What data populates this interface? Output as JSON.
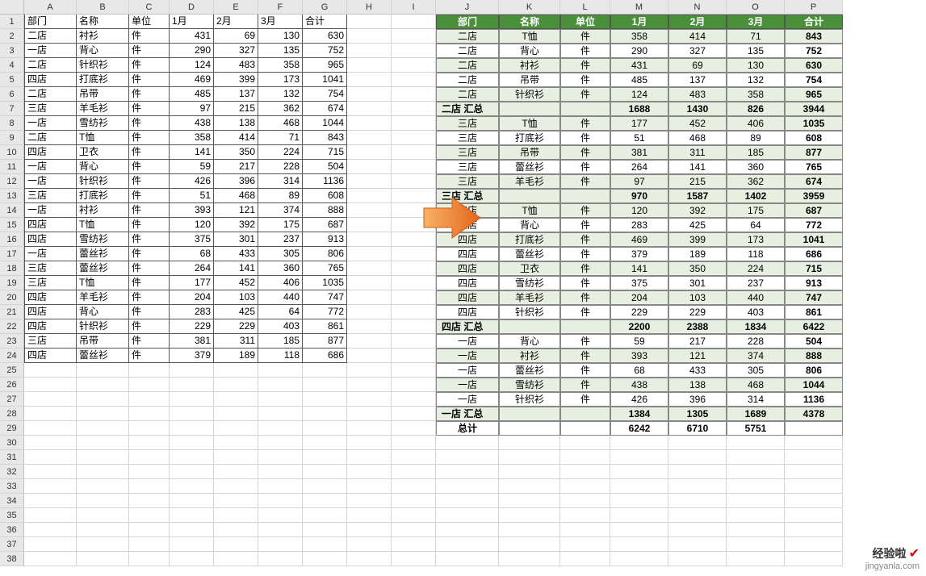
{
  "columns": [
    "A",
    "B",
    "C",
    "D",
    "E",
    "F",
    "G",
    "H",
    "I",
    "J",
    "K",
    "L",
    "M",
    "N",
    "O",
    "P"
  ],
  "row_count": 38,
  "left_table": {
    "headers": [
      "部门",
      "名称",
      "单位",
      "1月",
      "2月",
      "3月",
      "合计"
    ],
    "rows": [
      [
        "二店",
        "衬衫",
        "件",
        431,
        69,
        130,
        630
      ],
      [
        "一店",
        "背心",
        "件",
        290,
        327,
        135,
        752
      ],
      [
        "二店",
        "针织衫",
        "件",
        124,
        483,
        358,
        965
      ],
      [
        "四店",
        "打底衫",
        "件",
        469,
        399,
        173,
        1041
      ],
      [
        "二店",
        "吊带",
        "件",
        485,
        137,
        132,
        754
      ],
      [
        "三店",
        "羊毛衫",
        "件",
        97,
        215,
        362,
        674
      ],
      [
        "一店",
        "雪纺衫",
        "件",
        438,
        138,
        468,
        1044
      ],
      [
        "二店",
        "T恤",
        "件",
        358,
        414,
        71,
        843
      ],
      [
        "四店",
        "卫衣",
        "件",
        141,
        350,
        224,
        715
      ],
      [
        "一店",
        "背心",
        "件",
        59,
        217,
        228,
        504
      ],
      [
        "一店",
        "针织衫",
        "件",
        426,
        396,
        314,
        1136
      ],
      [
        "三店",
        "打底衫",
        "件",
        51,
        468,
        89,
        608
      ],
      [
        "一店",
        "衬衫",
        "件",
        393,
        121,
        374,
        888
      ],
      [
        "四店",
        "T恤",
        "件",
        120,
        392,
        175,
        687
      ],
      [
        "四店",
        "雪纺衫",
        "件",
        375,
        301,
        237,
        913
      ],
      [
        "一店",
        "蕾丝衫",
        "件",
        68,
        433,
        305,
        806
      ],
      [
        "三店",
        "蕾丝衫",
        "件",
        264,
        141,
        360,
        765
      ],
      [
        "三店",
        "T恤",
        "件",
        177,
        452,
        406,
        1035
      ],
      [
        "四店",
        "羊毛衫",
        "件",
        204,
        103,
        440,
        747
      ],
      [
        "四店",
        "背心",
        "件",
        283,
        425,
        64,
        772
      ],
      [
        "四店",
        "针织衫",
        "件",
        229,
        229,
        403,
        861
      ],
      [
        "三店",
        "吊带",
        "件",
        381,
        311,
        185,
        877
      ],
      [
        "四店",
        "蕾丝衫",
        "件",
        379,
        189,
        118,
        686
      ]
    ]
  },
  "right_table": {
    "headers": [
      "部门",
      "名称",
      "单位",
      "1月",
      "2月",
      "3月",
      "合计"
    ],
    "groups": [
      {
        "rows": [
          [
            "二店",
            "T恤",
            "件",
            358,
            414,
            71,
            843
          ],
          [
            "二店",
            "背心",
            "件",
            290,
            327,
            135,
            752
          ],
          [
            "二店",
            "衬衫",
            "件",
            431,
            69,
            130,
            630
          ],
          [
            "二店",
            "吊带",
            "件",
            485,
            137,
            132,
            754
          ],
          [
            "二店",
            "针织衫",
            "件",
            124,
            483,
            358,
            965
          ]
        ],
        "subtotal_label": "二店 汇总",
        "subtotal": [
          1688,
          1430,
          826,
          3944
        ]
      },
      {
        "rows": [
          [
            "三店",
            "T恤",
            "件",
            177,
            452,
            406,
            1035
          ],
          [
            "三店",
            "打底衫",
            "件",
            51,
            468,
            89,
            608
          ],
          [
            "三店",
            "吊带",
            "件",
            381,
            311,
            185,
            877
          ],
          [
            "三店",
            "蕾丝衫",
            "件",
            264,
            141,
            360,
            765
          ],
          [
            "三店",
            "羊毛衫",
            "件",
            97,
            215,
            362,
            674
          ]
        ],
        "subtotal_label": "三店 汇总",
        "subtotal": [
          970,
          1587,
          1402,
          3959
        ]
      },
      {
        "rows": [
          [
            "四店",
            "T恤",
            "件",
            120,
            392,
            175,
            687
          ],
          [
            "四店",
            "背心",
            "件",
            283,
            425,
            64,
            772
          ],
          [
            "四店",
            "打底衫",
            "件",
            469,
            399,
            173,
            1041
          ],
          [
            "四店",
            "蕾丝衫",
            "件",
            379,
            189,
            118,
            686
          ],
          [
            "四店",
            "卫衣",
            "件",
            141,
            350,
            224,
            715
          ],
          [
            "四店",
            "雪纺衫",
            "件",
            375,
            301,
            237,
            913
          ],
          [
            "四店",
            "羊毛衫",
            "件",
            204,
            103,
            440,
            747
          ],
          [
            "四店",
            "针织衫",
            "件",
            229,
            229,
            403,
            861
          ]
        ],
        "subtotal_label": "四店 汇总",
        "subtotal": [
          2200,
          2388,
          1834,
          6422
        ]
      },
      {
        "rows": [
          [
            "一店",
            "背心",
            "件",
            59,
            217,
            228,
            504
          ],
          [
            "一店",
            "衬衫",
            "件",
            393,
            121,
            374,
            888
          ],
          [
            "一店",
            "蕾丝衫",
            "件",
            68,
            433,
            305,
            806
          ],
          [
            "一店",
            "雪纺衫",
            "件",
            438,
            138,
            468,
            1044
          ],
          [
            "一店",
            "针织衫",
            "件",
            426,
            396,
            314,
            1136
          ]
        ],
        "subtotal_label": "一店 汇总",
        "subtotal": [
          1384,
          1305,
          1689,
          4378
        ]
      }
    ],
    "total_label": "总计",
    "total": [
      6242,
      6710,
      5751,
      ""
    ]
  },
  "watermark": {
    "brand": "经验啦",
    "check": "✔",
    "url": "jingyanla.com"
  },
  "colors": {
    "header_green": "#4a8f3a",
    "stripe": "#e7f0e0"
  }
}
